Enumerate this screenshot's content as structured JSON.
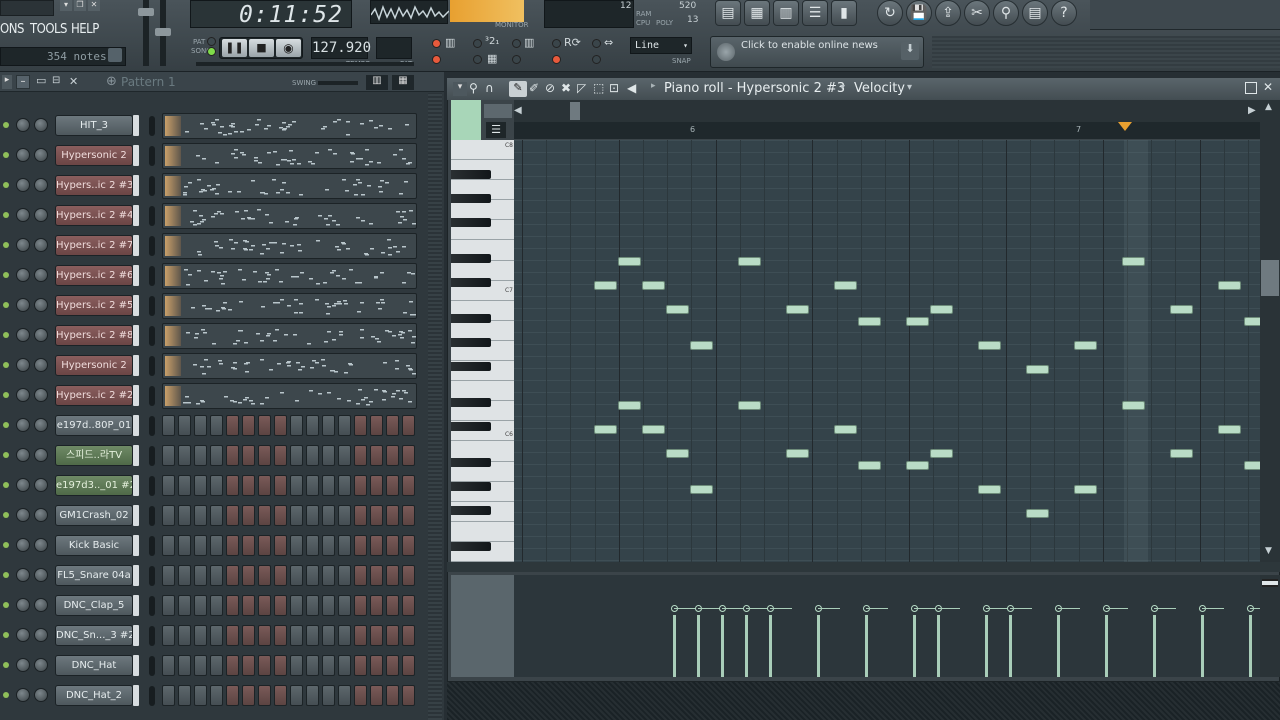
{
  "topbar": {
    "menus": [
      "ONS",
      "TOOLS",
      "HELP"
    ],
    "notes_count": "354 notes",
    "time": "0:11:52",
    "tempo": "127.920",
    "tempo_label": "TEMPO",
    "pat_label": "PAT",
    "song_label": "SONG",
    "pat_led_label": "PAT",
    "monitor_label": "MONITOR",
    "cpu_label": "CPU",
    "poly_label": "POLY",
    "ram_label": "RAM",
    "cpu_value": "12",
    "ram_value": "520",
    "poly_value": "13",
    "snap_value": "Line",
    "snap_label": "SNAP",
    "news": "Click to enable online news"
  },
  "rack": {
    "pattern_name": "Pattern 1",
    "swing_label": "SWING",
    "channels": [
      {
        "name": "HIT_3",
        "style": "grey",
        "kind": "pattern"
      },
      {
        "name": "Hypersonic 2",
        "style": "red",
        "kind": "pattern"
      },
      {
        "name": "Hypers..ic 2 #3",
        "style": "red",
        "kind": "pattern"
      },
      {
        "name": "Hypers..ic 2 #4",
        "style": "red",
        "kind": "pattern"
      },
      {
        "name": "Hypers..ic 2 #7",
        "style": "red",
        "kind": "pattern"
      },
      {
        "name": "Hypers..ic 2 #6",
        "style": "red",
        "kind": "pattern"
      },
      {
        "name": "Hypers..ic 2 #5",
        "style": "red",
        "kind": "pattern"
      },
      {
        "name": "Hypers..ic 2 #8",
        "style": "red",
        "kind": "pattern"
      },
      {
        "name": "Hypersonic 2",
        "style": "red",
        "kind": "pattern"
      },
      {
        "name": "Hypers..ic 2 #2",
        "style": "red",
        "kind": "pattern"
      },
      {
        "name": "e197d..80P_01",
        "style": "grey",
        "kind": "steps"
      },
      {
        "name": "스피드..라TV",
        "style": "green",
        "kind": "steps"
      },
      {
        "name": "e197d3.._01 #2",
        "style": "green",
        "kind": "steps"
      },
      {
        "name": "GM1Crash_02",
        "style": "grey",
        "kind": "steps"
      },
      {
        "name": "Kick Basic",
        "style": "grey",
        "kind": "steps"
      },
      {
        "name": "FL5_Snare 04a",
        "style": "grey",
        "kind": "steps"
      },
      {
        "name": "DNC_Clap_5",
        "style": "grey",
        "kind": "steps"
      },
      {
        "name": "DNC_Sn..._3 #2",
        "style": "grey",
        "kind": "steps"
      },
      {
        "name": "DNC_Hat",
        "style": "grey",
        "kind": "steps"
      },
      {
        "name": "DNC_Hat_2",
        "style": "grey",
        "kind": "steps"
      }
    ]
  },
  "pianoroll": {
    "title": "Piano roll - Hypersonic 2 #3",
    "target": "Velocity",
    "bar_labels": [
      "6",
      "7"
    ],
    "key_labels": [
      "C8",
      "C7",
      "C6"
    ]
  },
  "colors": {
    "note": "#b9dcc6",
    "grid_bg": "#34434a",
    "accent_orange": "#e8a030"
  }
}
